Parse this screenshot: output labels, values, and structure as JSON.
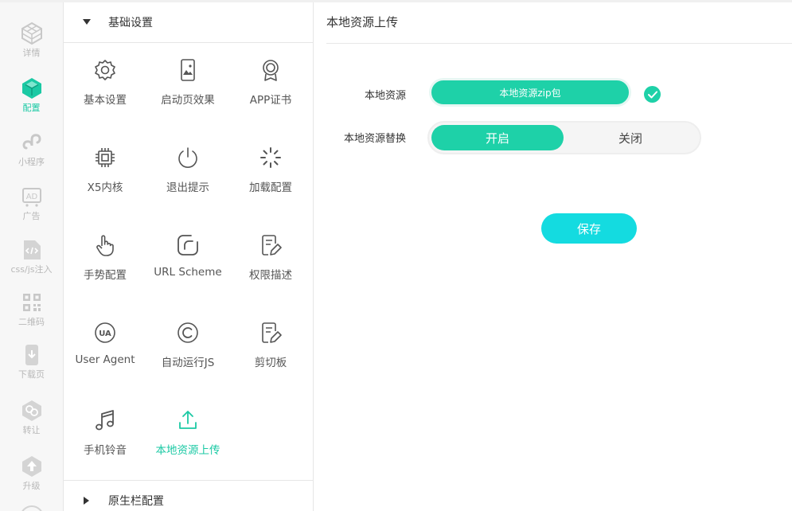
{
  "rail": {
    "items": [
      {
        "label": "详情",
        "icon": "cube-outline-icon"
      },
      {
        "label": "配置",
        "icon": "cube-solid-icon"
      },
      {
        "label": "小程序",
        "icon": "mini-program-icon"
      },
      {
        "label": "广告",
        "icon": "ad-icon"
      },
      {
        "label": "css/js注入",
        "icon": "code-file-icon"
      },
      {
        "label": "二维码",
        "icon": "qrcode-icon"
      },
      {
        "label": "下载页",
        "icon": "download-page-icon"
      },
      {
        "label": "转让",
        "icon": "transfer-icon"
      },
      {
        "label": "升级",
        "icon": "upgrade-icon"
      }
    ],
    "active_index": 1
  },
  "menu": {
    "section_basic": "基础设置",
    "section_native": "原生栏配置",
    "tiles": [
      {
        "label": "基本设置",
        "icon": "gear-icon"
      },
      {
        "label": "启动页效果",
        "icon": "splash-image-icon"
      },
      {
        "label": "APP证书",
        "icon": "certificate-icon"
      },
      {
        "label": "X5内核",
        "icon": "chip-icon"
      },
      {
        "label": "退出提示",
        "icon": "power-icon"
      },
      {
        "label": "加载配置",
        "icon": "loading-spinner-icon"
      },
      {
        "label": "手势配置",
        "icon": "hand-pointer-icon"
      },
      {
        "label": "URL Scheme",
        "icon": "url-scheme-icon"
      },
      {
        "label": "权限描述",
        "icon": "edit-document-icon"
      },
      {
        "label": "User Agent",
        "icon": "ua-icon"
      },
      {
        "label": "自动运行JS",
        "icon": "copyright-c-icon"
      },
      {
        "label": "剪切板",
        "icon": "clipboard-edit-icon"
      },
      {
        "label": "手机铃音",
        "icon": "music-note-icon"
      },
      {
        "label": "本地资源上传",
        "icon": "upload-icon"
      }
    ],
    "active_tile": "本地资源上传"
  },
  "content": {
    "title": "本地资源上传",
    "local_resource_label": "本地资源",
    "upload_button": "本地资源zip包",
    "replace_label": "本地资源替换",
    "toggle_on": "开启",
    "toggle_off": "关闭",
    "save_button": "保存"
  },
  "colors": {
    "accent": "#1ed1a8",
    "save": "#14dbe0",
    "rail_text": "#b8b8b8"
  }
}
